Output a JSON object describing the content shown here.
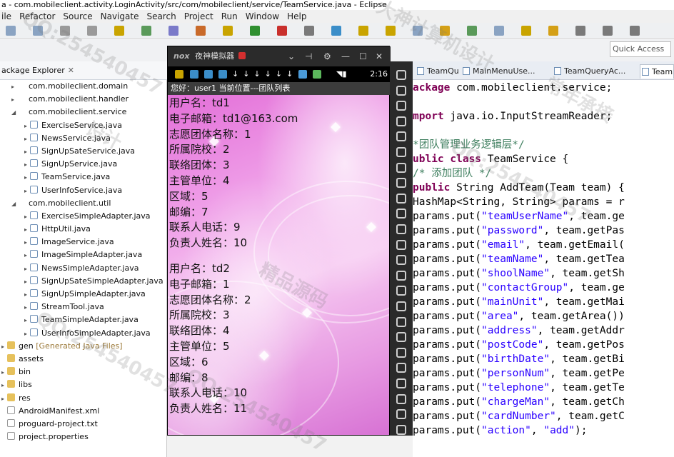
{
  "window": {
    "title": "a - com.mobileclient.activity.LoginActivity/src/com/mobileclient/service/TeamService.java - Eclipse"
  },
  "menu": [
    "ile",
    "Refactor",
    "Source",
    "Navigate",
    "Search",
    "Project",
    "Run",
    "Window",
    "Help"
  ],
  "quick_access": "Quick Access",
  "package_explorer": {
    "tab_label": "ackage Explorer",
    "items": [
      {
        "label": "com.mobileclient.domain",
        "kind": "package",
        "indent": 1,
        "toggle": "▸"
      },
      {
        "label": "com.mobileclient.handler",
        "kind": "package",
        "indent": 1,
        "toggle": "▸"
      },
      {
        "label": "com.mobileclient.service",
        "kind": "package",
        "indent": 1,
        "toggle": "◢"
      },
      {
        "label": "ExerciseService.java",
        "kind": "java",
        "indent": 2,
        "toggle": "▸"
      },
      {
        "label": "NewsService.java",
        "kind": "java",
        "indent": 2,
        "toggle": "▸"
      },
      {
        "label": "SignUpSateService.java",
        "kind": "java",
        "indent": 2,
        "toggle": "▸"
      },
      {
        "label": "SignUpService.java",
        "kind": "java",
        "indent": 2,
        "toggle": "▸"
      },
      {
        "label": "TeamService.java",
        "kind": "java",
        "indent": 2,
        "toggle": "▸"
      },
      {
        "label": "UserInfoService.java",
        "kind": "java",
        "indent": 2,
        "toggle": "▸"
      },
      {
        "label": "com.mobileclient.util",
        "kind": "package",
        "indent": 1,
        "toggle": "◢"
      },
      {
        "label": "ExerciseSimpleAdapter.java",
        "kind": "java",
        "indent": 2,
        "toggle": "▸"
      },
      {
        "label": "HttpUtil.java",
        "kind": "java",
        "indent": 2,
        "toggle": "▸"
      },
      {
        "label": "ImageService.java",
        "kind": "java",
        "indent": 2,
        "toggle": "▸"
      },
      {
        "label": "ImageSimpleAdapter.java",
        "kind": "java",
        "indent": 2,
        "toggle": "▸"
      },
      {
        "label": "NewsSimpleAdapter.java",
        "kind": "java",
        "indent": 2,
        "toggle": "▸"
      },
      {
        "label": "SignUpSateSimpleAdapter.java",
        "kind": "java",
        "indent": 2,
        "toggle": "▸"
      },
      {
        "label": "SignUpSimpleAdapter.java",
        "kind": "java",
        "indent": 2,
        "toggle": "▸"
      },
      {
        "label": "StreamTool.java",
        "kind": "java",
        "indent": 2,
        "toggle": "▸"
      },
      {
        "label": "TeamSimpleAdapter.java",
        "kind": "java",
        "indent": 2,
        "toggle": "▸"
      },
      {
        "label": "UserInfoSimpleAdapter.java",
        "kind": "java",
        "indent": 2,
        "toggle": "▸"
      },
      {
        "label": "gen",
        "suffix": "[Generated Java Files]",
        "kind": "folder",
        "indent": 0,
        "toggle": "▸"
      },
      {
        "label": "assets",
        "kind": "folder",
        "indent": 0,
        "toggle": ""
      },
      {
        "label": "bin",
        "kind": "folder",
        "indent": 0,
        "toggle": "▸"
      },
      {
        "label": "libs",
        "kind": "folder",
        "indent": 0,
        "toggle": "▸"
      },
      {
        "label": "res",
        "kind": "folder",
        "indent": 0,
        "toggle": "▸"
      },
      {
        "label": "AndroidManifest.xml",
        "kind": "file",
        "indent": 0,
        "toggle": ""
      },
      {
        "label": "proguard-project.txt",
        "kind": "file",
        "indent": 0,
        "toggle": ""
      },
      {
        "label": "project.properties",
        "kind": "file",
        "indent": 0,
        "toggle": ""
      }
    ]
  },
  "emulator": {
    "logo": "nox",
    "title": "夜神模拟器",
    "clock": "2:16",
    "header": "您好：user1   当前位置---团队列表",
    "records": [
      {
        "lines": [
          "用户名：td1",
          "电子邮箱：td1@163.com",
          "志愿团体名称：1",
          "所属院校：2",
          "联络团体：3",
          "主管单位：4",
          "区域：5",
          "邮编：7",
          "联系人电话：9",
          "负责人姓名：10"
        ]
      },
      {
        "lines": [
          "用户名：td2",
          "电子邮箱：1",
          "志愿团体名称：2",
          "所属院校：3",
          "联络团体：4",
          "主管单位：5",
          "区域：6",
          "邮编：8",
          "联系人电话：10",
          "负责人姓名：11"
        ]
      }
    ]
  },
  "editor": {
    "tabs": [
      "TeamQu...",
      "MainMenuUse...",
      "TeamQueryAc...",
      "TeamS"
    ],
    "code": [
      {
        "parts": [
          [
            "kw",
            "ackage"
          ],
          [
            "",
            " com.mobileclient.service;"
          ]
        ]
      },
      {
        "parts": []
      },
      {
        "parts": [
          [
            "kw",
            "mport"
          ],
          [
            "",
            " java.io.InputStreamReader;"
          ]
        ]
      },
      {
        "parts": []
      },
      {
        "parts": [
          [
            "cm",
            "*团队管理业务逻辑层*/"
          ]
        ]
      },
      {
        "parts": [
          [
            "kw",
            "ublic class"
          ],
          [
            "",
            " TeamService {"
          ]
        ]
      },
      {
        "parts": [
          [
            "cm",
            "   /*  添加团队 */"
          ]
        ]
      },
      {
        "parts": [
          [
            "kw",
            "    public"
          ],
          [
            "",
            " String AddTeam(Team team) {"
          ]
        ]
      },
      {
        "parts": [
          [
            "",
            "       HashMap<String, String> params = r"
          ]
        ]
      },
      {
        "parts": [
          [
            "",
            "       params.put("
          ],
          [
            "str",
            "\"teamUserName\""
          ],
          [
            "",
            ", team.ge"
          ]
        ]
      },
      {
        "parts": [
          [
            "",
            "       params.put("
          ],
          [
            "str",
            "\"password\""
          ],
          [
            "",
            ", team.getPas"
          ]
        ]
      },
      {
        "parts": [
          [
            "",
            "       params.put("
          ],
          [
            "str",
            "\"email\""
          ],
          [
            "",
            ", team.getEmail("
          ]
        ]
      },
      {
        "parts": [
          [
            "",
            "       params.put("
          ],
          [
            "str",
            "\"teamName\""
          ],
          [
            "",
            ", team.getTea"
          ]
        ]
      },
      {
        "parts": [
          [
            "",
            "       params.put("
          ],
          [
            "str",
            "\"shoolName\""
          ],
          [
            "",
            ", team.getSh"
          ]
        ]
      },
      {
        "parts": [
          [
            "",
            "       params.put("
          ],
          [
            "str",
            "\"contactGroup\""
          ],
          [
            "",
            ", team.ge"
          ]
        ]
      },
      {
        "parts": [
          [
            "",
            "       params.put("
          ],
          [
            "str",
            "\"mainUnit\""
          ],
          [
            "",
            ", team.getMai"
          ]
        ]
      },
      {
        "parts": [
          [
            "",
            "       params.put("
          ],
          [
            "str",
            "\"area\""
          ],
          [
            "",
            ", team.getArea())"
          ]
        ]
      },
      {
        "parts": [
          [
            "",
            "       params.put("
          ],
          [
            "str",
            "\"address\""
          ],
          [
            "",
            ", team.getAddr"
          ]
        ]
      },
      {
        "parts": [
          [
            "",
            "       params.put("
          ],
          [
            "str",
            "\"postCode\""
          ],
          [
            "",
            ", team.getPos"
          ]
        ]
      },
      {
        "parts": [
          [
            "",
            "       params.put("
          ],
          [
            "str",
            "\"birthDate\""
          ],
          [
            "",
            ", team.getBi"
          ]
        ]
      },
      {
        "parts": [
          [
            "",
            "       params.put("
          ],
          [
            "str",
            "\"personNum\""
          ],
          [
            "",
            ", team.getPe"
          ]
        ]
      },
      {
        "parts": [
          [
            "",
            "       params.put("
          ],
          [
            "str",
            "\"telephone\""
          ],
          [
            "",
            ", team.getTe"
          ]
        ]
      },
      {
        "parts": [
          [
            "",
            "       params.put("
          ],
          [
            "str",
            "\"chargeMan\""
          ],
          [
            "",
            ", team.getCh"
          ]
        ]
      },
      {
        "parts": [
          [
            "",
            "       params.put("
          ],
          [
            "str",
            "\"cardNumber\""
          ],
          [
            "",
            ", team.getC"
          ]
        ]
      },
      {
        "parts": [
          [
            "",
            "       params.put("
          ],
          [
            "str",
            "\"action\""
          ],
          [
            "",
            ", "
          ],
          [
            "str",
            "\"add\""
          ],
          [
            "",
            ");"
          ]
        ]
      }
    ]
  },
  "watermarks": [
    "QQ:254540457",
    "大神计算机设计",
    "QQ:254540457",
    "精品源码",
    "QQ:254540457",
    "常年承接",
    "QQ:254540457",
    "设计"
  ],
  "colors": {
    "keyword": "#7f0055",
    "string": "#2a00ff",
    "comment": "#3f7f5f",
    "screen_pink": "#e36fd8"
  }
}
